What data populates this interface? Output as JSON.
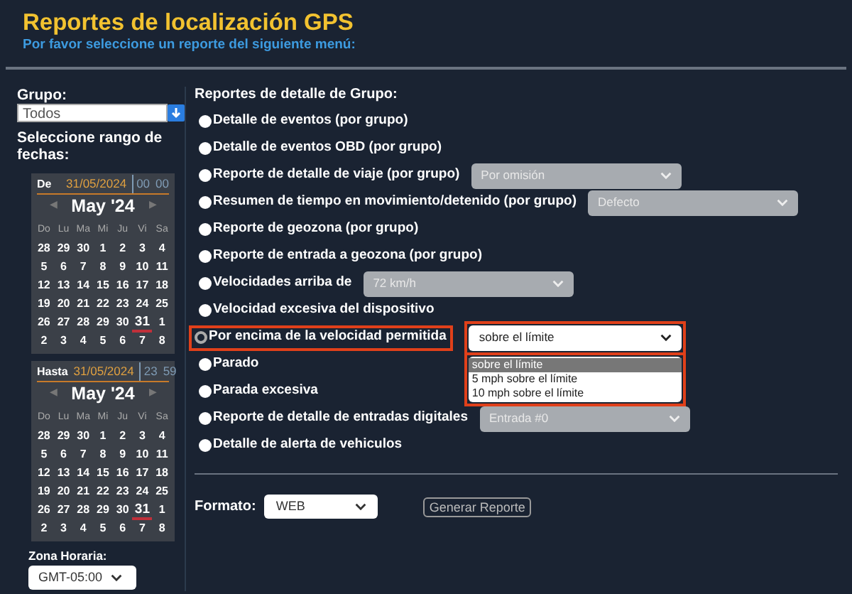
{
  "header": {
    "title": "Reportes de localización GPS",
    "subtitle": "Por favor seleccione un reporte del siguiente menú:"
  },
  "sidebar": {
    "group_label": "Grupo:",
    "group_value": "Todos",
    "range_label": "Seleccione rango de fechas:",
    "calendars": [
      {
        "label": "De",
        "date": "31/05/2024",
        "hour": "00",
        "minute": "00",
        "month": "May '24",
        "prev": "◀",
        "next": "▶",
        "weekdays": [
          "Do",
          "Lu",
          "Ma",
          "Mi",
          "Ju",
          "Vi",
          "Sa"
        ],
        "weeks": [
          [
            {
              "d": "28",
              "selected": false
            },
            {
              "d": "29",
              "selected": false
            },
            {
              "d": "30",
              "selected": false
            },
            {
              "d": "1",
              "selected": false
            },
            {
              "d": "2",
              "selected": false
            },
            {
              "d": "3",
              "selected": false
            },
            {
              "d": "4",
              "selected": false
            }
          ],
          [
            {
              "d": "5",
              "selected": false
            },
            {
              "d": "6",
              "selected": false
            },
            {
              "d": "7",
              "selected": false
            },
            {
              "d": "8",
              "selected": false
            },
            {
              "d": "9",
              "selected": false
            },
            {
              "d": "10",
              "selected": false
            },
            {
              "d": "11",
              "selected": false
            }
          ],
          [
            {
              "d": "12",
              "selected": false
            },
            {
              "d": "13",
              "selected": false
            },
            {
              "d": "14",
              "selected": false
            },
            {
              "d": "15",
              "selected": false
            },
            {
              "d": "16",
              "selected": false
            },
            {
              "d": "17",
              "selected": false
            },
            {
              "d": "18",
              "selected": false
            }
          ],
          [
            {
              "d": "19",
              "selected": false
            },
            {
              "d": "20",
              "selected": false
            },
            {
              "d": "21",
              "selected": false
            },
            {
              "d": "22",
              "selected": false
            },
            {
              "d": "23",
              "selected": false
            },
            {
              "d": "24",
              "selected": false
            },
            {
              "d": "25",
              "selected": false
            }
          ],
          [
            {
              "d": "26",
              "selected": false
            },
            {
              "d": "27",
              "selected": false
            },
            {
              "d": "28",
              "selected": false
            },
            {
              "d": "29",
              "selected": false
            },
            {
              "d": "30",
              "selected": false
            },
            {
              "d": "31",
              "selected": true
            },
            {
              "d": "1",
              "selected": false
            }
          ],
          [
            {
              "d": "2",
              "selected": false
            },
            {
              "d": "3",
              "selected": false
            },
            {
              "d": "4",
              "selected": false
            },
            {
              "d": "5",
              "selected": false
            },
            {
              "d": "6",
              "selected": false
            },
            {
              "d": "7",
              "selected": false
            },
            {
              "d": "8",
              "selected": false
            }
          ]
        ]
      },
      {
        "label": "Hasta",
        "date": "31/05/2024",
        "hour": "23",
        "minute": "59",
        "month": "May '24",
        "prev": "◀",
        "next": "▶",
        "weekdays": [
          "Do",
          "Lu",
          "Ma",
          "Mi",
          "Ju",
          "Vi",
          "Sa"
        ],
        "weeks": [
          [
            {
              "d": "28",
              "selected": false
            },
            {
              "d": "29",
              "selected": false
            },
            {
              "d": "30",
              "selected": false
            },
            {
              "d": "1",
              "selected": false
            },
            {
              "d": "2",
              "selected": false
            },
            {
              "d": "3",
              "selected": false
            },
            {
              "d": "4",
              "selected": false
            }
          ],
          [
            {
              "d": "5",
              "selected": false
            },
            {
              "d": "6",
              "selected": false
            },
            {
              "d": "7",
              "selected": false
            },
            {
              "d": "8",
              "selected": false
            },
            {
              "d": "9",
              "selected": false
            },
            {
              "d": "10",
              "selected": false
            },
            {
              "d": "11",
              "selected": false
            }
          ],
          [
            {
              "d": "12",
              "selected": false
            },
            {
              "d": "13",
              "selected": false
            },
            {
              "d": "14",
              "selected": false
            },
            {
              "d": "15",
              "selected": false
            },
            {
              "d": "16",
              "selected": false
            },
            {
              "d": "17",
              "selected": false
            },
            {
              "d": "18",
              "selected": false
            }
          ],
          [
            {
              "d": "19",
              "selected": false
            },
            {
              "d": "20",
              "selected": false
            },
            {
              "d": "21",
              "selected": false
            },
            {
              "d": "22",
              "selected": false
            },
            {
              "d": "23",
              "selected": false
            },
            {
              "d": "24",
              "selected": false
            },
            {
              "d": "25",
              "selected": false
            }
          ],
          [
            {
              "d": "26",
              "selected": false
            },
            {
              "d": "27",
              "selected": false
            },
            {
              "d": "28",
              "selected": false
            },
            {
              "d": "29",
              "selected": false
            },
            {
              "d": "30",
              "selected": false
            },
            {
              "d": "31",
              "selected": true
            },
            {
              "d": "1",
              "selected": false
            }
          ],
          [
            {
              "d": "2",
              "selected": false
            },
            {
              "d": "3",
              "selected": false
            },
            {
              "d": "4",
              "selected": false
            },
            {
              "d": "5",
              "selected": false
            },
            {
              "d": "6",
              "selected": false
            },
            {
              "d": "7",
              "selected": false
            },
            {
              "d": "8",
              "selected": false
            }
          ]
        ]
      }
    ],
    "timezone_label": "Zona Horaria:",
    "timezone_value": "GMT-05:00"
  },
  "reports": {
    "heading": "Reportes de detalle de Grupo:",
    "items": [
      {
        "label": "Detalle de eventos (por grupo)",
        "selected": false,
        "highlighted": false
      },
      {
        "label": "Detalle de eventos OBD (por grupo)",
        "selected": false,
        "highlighted": false
      },
      {
        "label": "Reporte de detalle de viaje (por grupo)",
        "selected": false,
        "highlighted": false,
        "select": {
          "value": "Por omisión",
          "disabled": true
        }
      },
      {
        "label": "Resumen de tiempo en movimiento/detenido (por grupo)",
        "selected": false,
        "highlighted": false,
        "select": {
          "value": "Defecto",
          "disabled": true
        }
      },
      {
        "label": "Reporte de geozona (por grupo)",
        "selected": false,
        "highlighted": false
      },
      {
        "label": "Reporte de entrada a geozona (por grupo)",
        "selected": false,
        "highlighted": false
      },
      {
        "label": "Velocidades arriba de",
        "selected": false,
        "highlighted": false,
        "select": {
          "value": "72 km/h",
          "disabled": true
        }
      },
      {
        "label": "Velocidad excesiva del dispositivo",
        "selected": false,
        "highlighted": false
      },
      {
        "label": "Por encima de la velocidad permitida",
        "selected": true,
        "highlighted": true,
        "select": {
          "value": "sobre el límite",
          "disabled": false,
          "expanded": true,
          "options": [
            {
              "label": "sobre el límite",
              "selected": true
            },
            {
              "label": "5 mph sobre el límite",
              "selected": false
            },
            {
              "label": "10 mph sobre el límite",
              "selected": false
            }
          ]
        }
      },
      {
        "label": "Parado",
        "selected": false,
        "highlighted": false
      },
      {
        "label": "Parada excesiva",
        "selected": false,
        "highlighted": false
      },
      {
        "label": "Reporte de detalle de entradas digitales",
        "selected": false,
        "highlighted": false,
        "select": {
          "value": "Entrada #0",
          "disabled": true
        }
      },
      {
        "label": "Detalle de alerta de vehiculos",
        "selected": false,
        "highlighted": false
      }
    ]
  },
  "footer": {
    "format_label": "Formato:",
    "format_value": "WEB",
    "button": "Generar Reporte"
  }
}
